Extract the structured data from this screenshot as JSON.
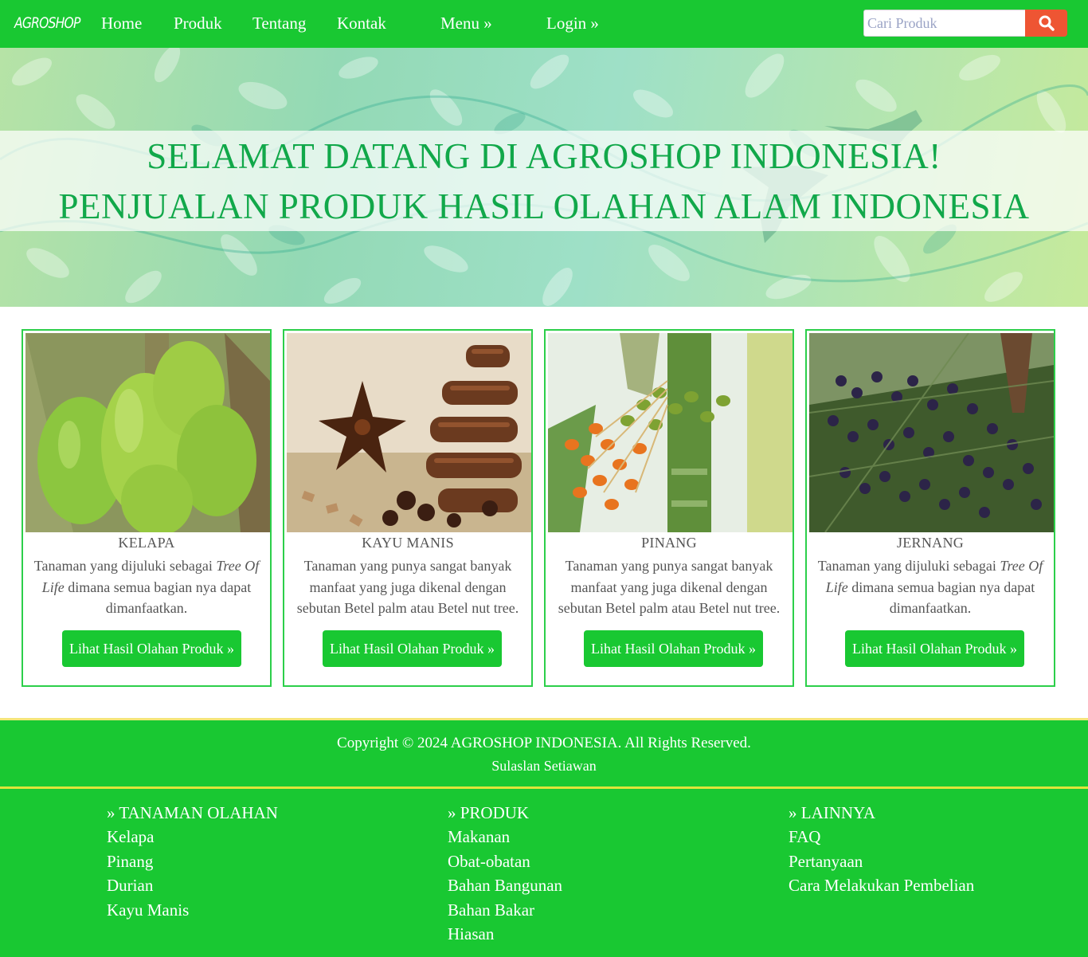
{
  "nav": {
    "brand": "AGROSHOP",
    "links": [
      "Home",
      "Produk",
      "Tentang",
      "Kontak",
      "Menu »",
      "Login »"
    ],
    "search_placeholder": "Cari Produk"
  },
  "hero": {
    "line1": "SELAMAT DATANG DI AGROSHOP INDONESIA!",
    "line2": "PENJUALAN PRODUK HASIL OLAHAN ALAM INDONESIA"
  },
  "cards": [
    {
      "title": "KELAPA",
      "desc_pre": "Tanaman yang dijuluki sebagai ",
      "desc_em": "Tree Of Life",
      "desc_post": " dimana semua bagian nya dapat dimanfaatkan.",
      "button": "Lihat Hasil Olahan Produk »"
    },
    {
      "title": "KAYU MANIS",
      "desc_pre": "Tanaman yang punya sangat banyak manfaat yang juga dikenal dengan sebutan Betel palm atau Betel nut tree.",
      "desc_em": "",
      "desc_post": "",
      "button": "Lihat Hasil Olahan Produk »"
    },
    {
      "title": "PINANG",
      "desc_pre": "Tanaman yang punya sangat banyak manfaat yang juga dikenal dengan sebutan Betel palm atau Betel nut tree.",
      "desc_em": "",
      "desc_post": "",
      "button": "Lihat Hasil Olahan Produk »"
    },
    {
      "title": "JERNANG",
      "desc_pre": "Tanaman yang dijuluki sebagai ",
      "desc_em": "Tree Of Life",
      "desc_post": " dimana semua bagian nya dapat dimanfaatkan.",
      "button": "Lihat Hasil Olahan Produk »"
    }
  ],
  "footer": {
    "copyright": "Copyright © 2024 AGROSHOP INDONESIA. All Rights Reserved.",
    "author": "Sulaslan Setiawan",
    "columns": [
      {
        "heading": "» TANAMAN OLAHAN",
        "links": [
          "Kelapa",
          "Pinang",
          "Durian",
          "Kayu Manis"
        ]
      },
      {
        "heading": "» PRODUK",
        "links": [
          "Makanan",
          "Obat-obatan",
          "Bahan Bangunan",
          "Bahan Bakar",
          "Hiasan"
        ]
      },
      {
        "heading": "» LAINNYA",
        "links": [
          "FAQ",
          "Pertanyaan",
          "Cara Melakukan Pembelian"
        ]
      }
    ]
  },
  "colors": {
    "nav_green": "#19c832",
    "search_button": "#ee5533",
    "hero_text": "#11a84a",
    "card_border": "#2ccf4a"
  },
  "icons": {
    "search": "search-icon"
  }
}
